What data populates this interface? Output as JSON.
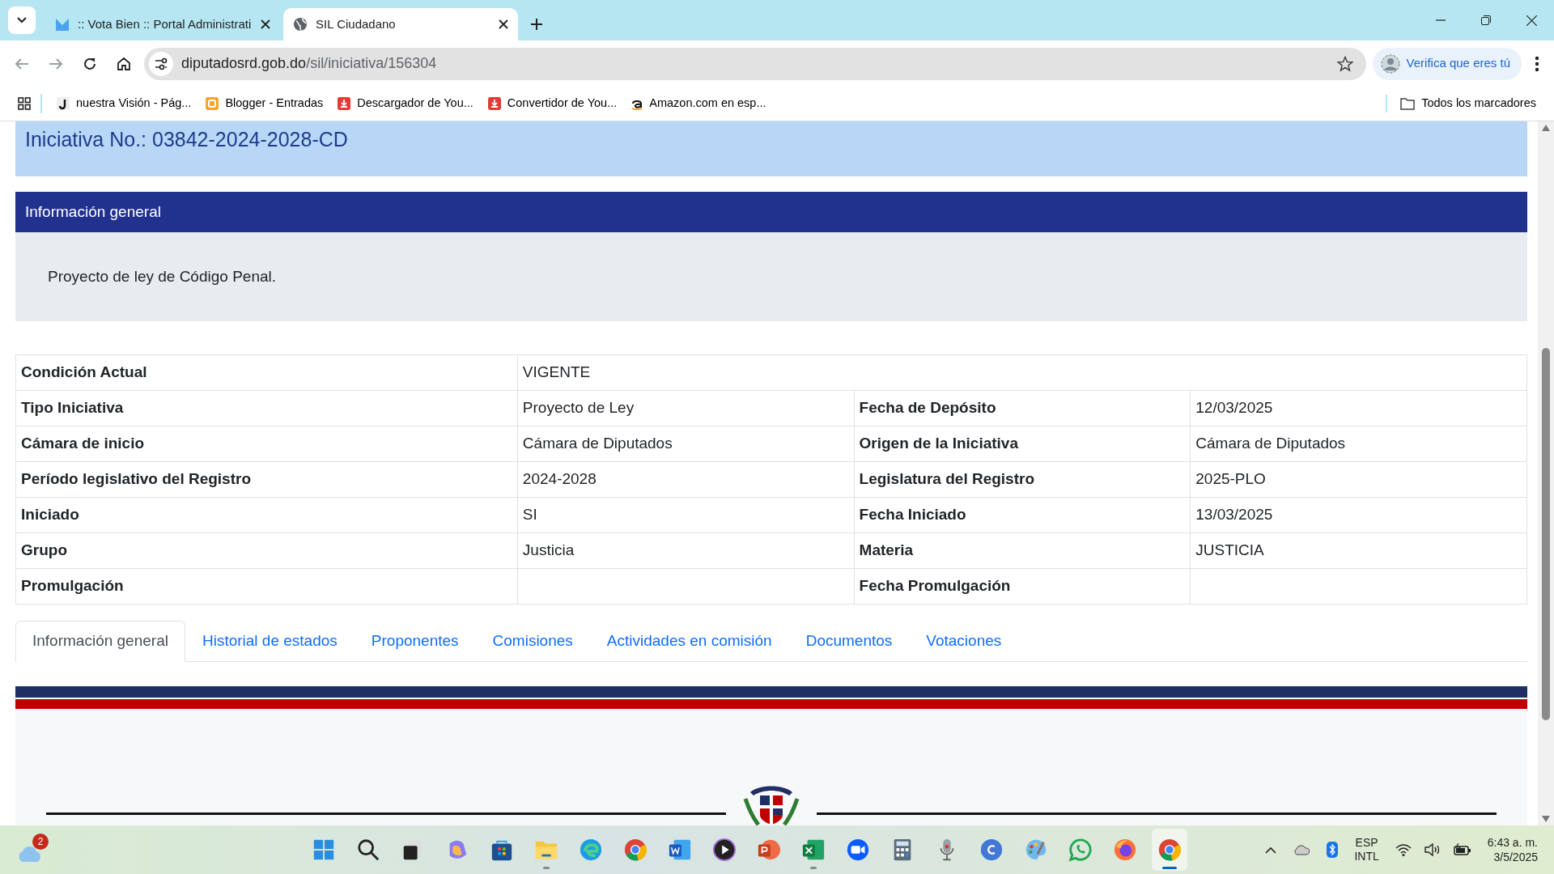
{
  "browser": {
    "tabs": [
      {
        "title": ":: Vota Bien :: Portal Administrati",
        "kind": "app",
        "selected": false
      },
      {
        "title": "SIL Ciudadano",
        "kind": "globe",
        "selected": true
      }
    ],
    "url": {
      "domain": "diputadosrd.gob.do",
      "path": "/sil/iniciativa/156304"
    },
    "profile_button": "Verifica que eres tú",
    "bookmarks": [
      {
        "label": "nuestra Visión - Pág...",
        "kind": "j"
      },
      {
        "label": "Blogger - Entradas",
        "kind": "blogger"
      },
      {
        "label": "Descargador de You...",
        "kind": "download"
      },
      {
        "label": "Convertidor de You...",
        "kind": "download"
      },
      {
        "label": "Amazon.com en esp...",
        "kind": "amazon"
      }
    ],
    "all_bookmarks": "Todos los marcadores"
  },
  "page": {
    "title": "Iniciativa No.: 03842-2024-2028-CD",
    "section_header": "Información general",
    "description": "Proyecto de ley de Código Penal.",
    "details": [
      [
        {
          "label": "Condición Actual",
          "value": "VIGENTE"
        }
      ],
      [
        {
          "label": "Tipo Iniciativa",
          "value": "Proyecto de Ley"
        },
        {
          "label": "Fecha de Depósito",
          "value": "12/03/2025"
        }
      ],
      [
        {
          "label": "Cámara de inicio",
          "value": "Cámara de Diputados"
        },
        {
          "label": "Origen de la Iniciativa",
          "value": "Cámara de Diputados"
        }
      ],
      [
        {
          "label": "Período legislativo del Registro",
          "value": "2024-2028"
        },
        {
          "label": "Legislatura del Registro",
          "value": "2025-PLO"
        }
      ],
      [
        {
          "label": "Iniciado",
          "value": "SI"
        },
        {
          "label": "Fecha Iniciado",
          "value": "13/03/2025"
        }
      ],
      [
        {
          "label": "Grupo",
          "value": "Justicia"
        },
        {
          "label": "Materia",
          "value": "JUSTICIA"
        }
      ],
      [
        {
          "label": "Promulgación"
        },
        {
          "label": "Fecha Promulgación"
        }
      ]
    ],
    "tabs": [
      {
        "label": "Información general",
        "selected": true
      },
      {
        "label": "Historial de estados",
        "selected": false
      },
      {
        "label": "Proponentes",
        "selected": false
      },
      {
        "label": "Comisiones",
        "selected": false
      },
      {
        "label": "Actividades en comisión",
        "selected": false
      },
      {
        "label": "Documentos",
        "selected": false
      },
      {
        "label": "Votaciones",
        "selected": false
      }
    ]
  },
  "taskbar": {
    "weather_badge": "2",
    "apps": [
      {
        "kind": "start",
        "running": false,
        "active": false
      },
      {
        "kind": "search",
        "running": false,
        "active": false
      },
      {
        "kind": "taskview",
        "running": false,
        "active": false
      },
      {
        "kind": "copilot",
        "running": false,
        "active": false
      },
      {
        "kind": "store",
        "running": false,
        "active": false
      },
      {
        "kind": "folder",
        "running": true,
        "active": false
      },
      {
        "kind": "edge",
        "running": false,
        "active": false
      },
      {
        "kind": "chrome",
        "running": false,
        "active": false
      },
      {
        "kind": "word",
        "running": false,
        "active": false
      },
      {
        "kind": "media",
        "running": false,
        "active": false
      },
      {
        "kind": "powerpoint",
        "running": false,
        "active": false
      },
      {
        "kind": "excel",
        "running": true,
        "active": false
      },
      {
        "kind": "zoom",
        "running": false,
        "active": false
      },
      {
        "kind": "calculator",
        "running": false,
        "active": false
      },
      {
        "kind": "microphone",
        "running": false,
        "active": false
      },
      {
        "kind": "canva",
        "running": false,
        "active": false
      },
      {
        "kind": "paint",
        "running": false,
        "active": false
      },
      {
        "kind": "whatsapp",
        "running": false,
        "active": false
      },
      {
        "kind": "firefox",
        "running": false,
        "active": false
      },
      {
        "kind": "chrome",
        "running": true,
        "active": true
      }
    ],
    "language": [
      "ESP",
      "INTL"
    ],
    "time": "6:43 a. m.",
    "date": "3/5/2025"
  }
}
